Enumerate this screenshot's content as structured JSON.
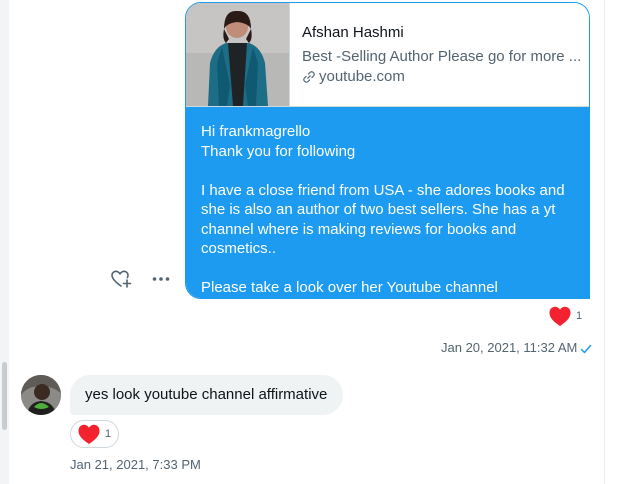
{
  "outgoing": {
    "preview": {
      "name": "Afshan Hashmi",
      "description": "Best -Selling Author Please go for more ...",
      "domain": "youtube.com"
    },
    "lines": [
      "Hi frankmagrello",
      "Thank you for following",
      "",
      "I have a close friend from USA - she adores books and",
      "she is also an author of two best sellers. She has a yt",
      "channel where is making reviews for books and",
      "cosmetics..",
      "",
      "Please take a look over  her Youtube channel"
    ],
    "reaction_count": "1",
    "timestamp": "Jan 20, 2021, 11:32 AM"
  },
  "incoming": {
    "text": "yes look youtube channel affirmative",
    "reaction_count": "1",
    "timestamp": "Jan 21, 2021, 7:33 PM"
  },
  "colors": {
    "accent": "#1d9bf0",
    "heart": "#f4212e",
    "incoming_bg": "#eff3f4"
  },
  "icons": {
    "react": "heart-plus-icon",
    "more": "more-horizontal-icon",
    "link": "link-icon",
    "seen": "checkmark-icon",
    "reaction": "heart-icon"
  }
}
